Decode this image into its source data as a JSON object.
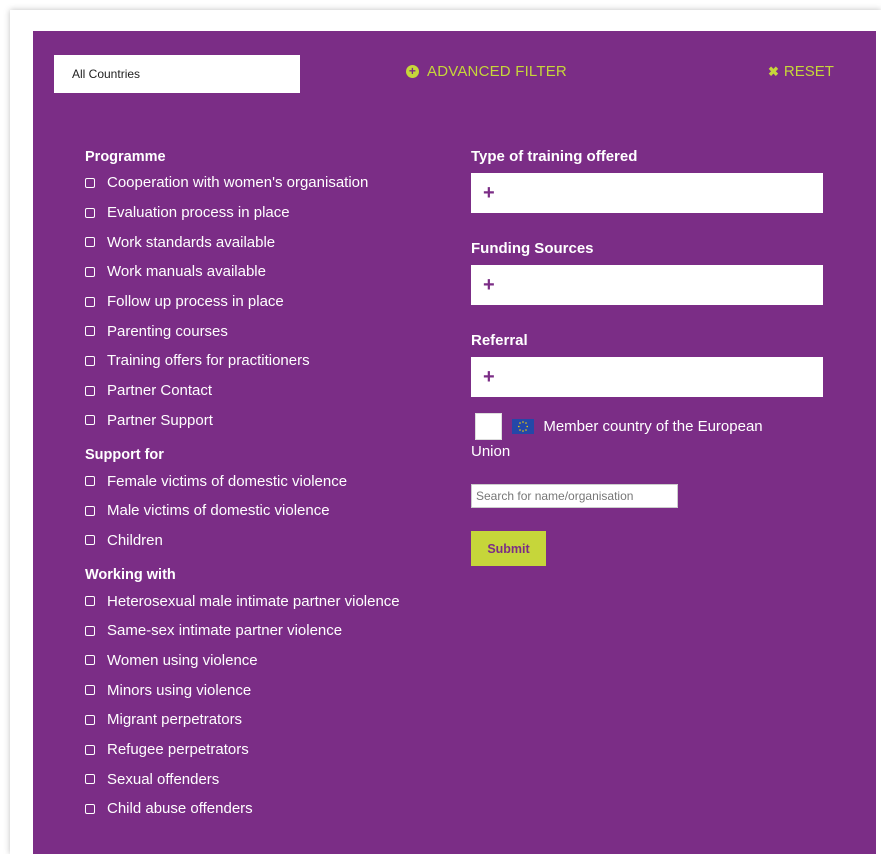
{
  "filter_bar": {
    "country_select": "All Countries",
    "advanced_filter": "ADVANCED FILTER",
    "reset": "RESET"
  },
  "groups": [
    {
      "title": "Programme",
      "items": [
        "Cooperation with women's organisation",
        "Evaluation process in place",
        "Work standards available",
        "Work manuals available",
        "Follow up process in place",
        "Parenting courses",
        "Training offers for practitioners",
        "Partner Contact",
        "Partner Support"
      ]
    },
    {
      "title": "Support for",
      "items": [
        "Female victims of domestic violence",
        "Male victims of domestic violence",
        "Children"
      ]
    },
    {
      "title": "Working with",
      "items": [
        "Heterosexual male intimate partner violence",
        "Same-sex intimate partner violence",
        "Women using violence",
        "Minors using violence",
        "Migrant perpetrators",
        "Refugee perpetrators",
        "Sexual offenders",
        "Child abuse offenders"
      ]
    }
  ],
  "fields": [
    {
      "title": "Type of training offered",
      "add_symbol": "+"
    },
    {
      "title": "Funding Sources",
      "add_symbol": "+"
    },
    {
      "title": "Referral",
      "add_symbol": "+"
    }
  ],
  "eu_member": {
    "label_line1": "Member country of the European",
    "label_line2": "Union",
    "flag_icon": "eu-flag-icon"
  },
  "search": {
    "placeholder": "Search for name/organisation",
    "value": ""
  },
  "submit_label": "Submit",
  "colors": {
    "panel": "#7b2d86",
    "accent": "#c6d63a",
    "text": "#ffffff"
  }
}
